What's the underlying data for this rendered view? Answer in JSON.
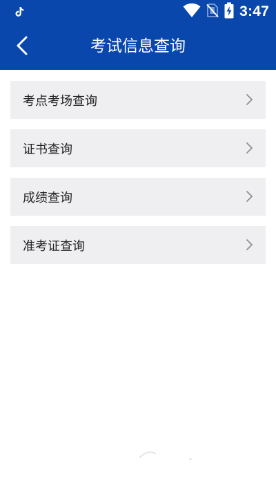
{
  "status_bar": {
    "time": "3:47",
    "icons": [
      "tiktok-icon",
      "wifi-icon",
      "no-sim-icon",
      "battery-charging-icon"
    ]
  },
  "header": {
    "title": "考试信息查询",
    "back_icon": "chevron-left-icon",
    "background_color": "#0a47ad"
  },
  "menu": {
    "items": [
      {
        "label": "考点考场查询"
      },
      {
        "label": "证书查询"
      },
      {
        "label": "成绩查询"
      },
      {
        "label": "准考证查询"
      }
    ],
    "item_background": "#efeff1",
    "chevron_icon": "chevron-right-icon"
  }
}
